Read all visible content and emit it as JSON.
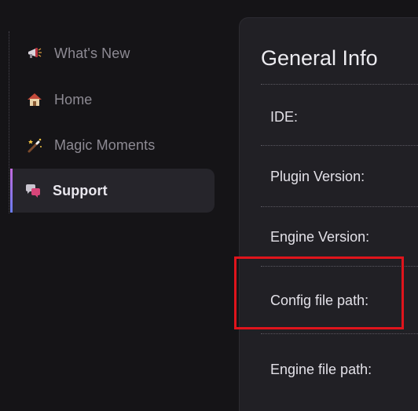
{
  "sidebar": {
    "items": [
      {
        "label": "What's New",
        "icon": "megaphone-icon",
        "active": false
      },
      {
        "label": "Home",
        "icon": "house-icon",
        "active": false
      },
      {
        "label": "Magic Moments",
        "icon": "magic-wand-icon",
        "active": false
      },
      {
        "label": "Support",
        "icon": "speech-bubbles-icon",
        "active": true
      }
    ],
    "accent_gradient": [
      "#c46be0",
      "#6a7cf0"
    ]
  },
  "panel": {
    "title": "General Info",
    "rows": [
      {
        "label": "IDE:"
      },
      {
        "label": "Plugin Version:"
      },
      {
        "label": "Engine Version:"
      },
      {
        "label": "Config file path:",
        "highlighted": true
      },
      {
        "label": "Engine file path:"
      }
    ]
  },
  "colors": {
    "background": "#151417",
    "panel": "#212025",
    "active_item": "#26252b",
    "highlight": "#e0141c"
  }
}
